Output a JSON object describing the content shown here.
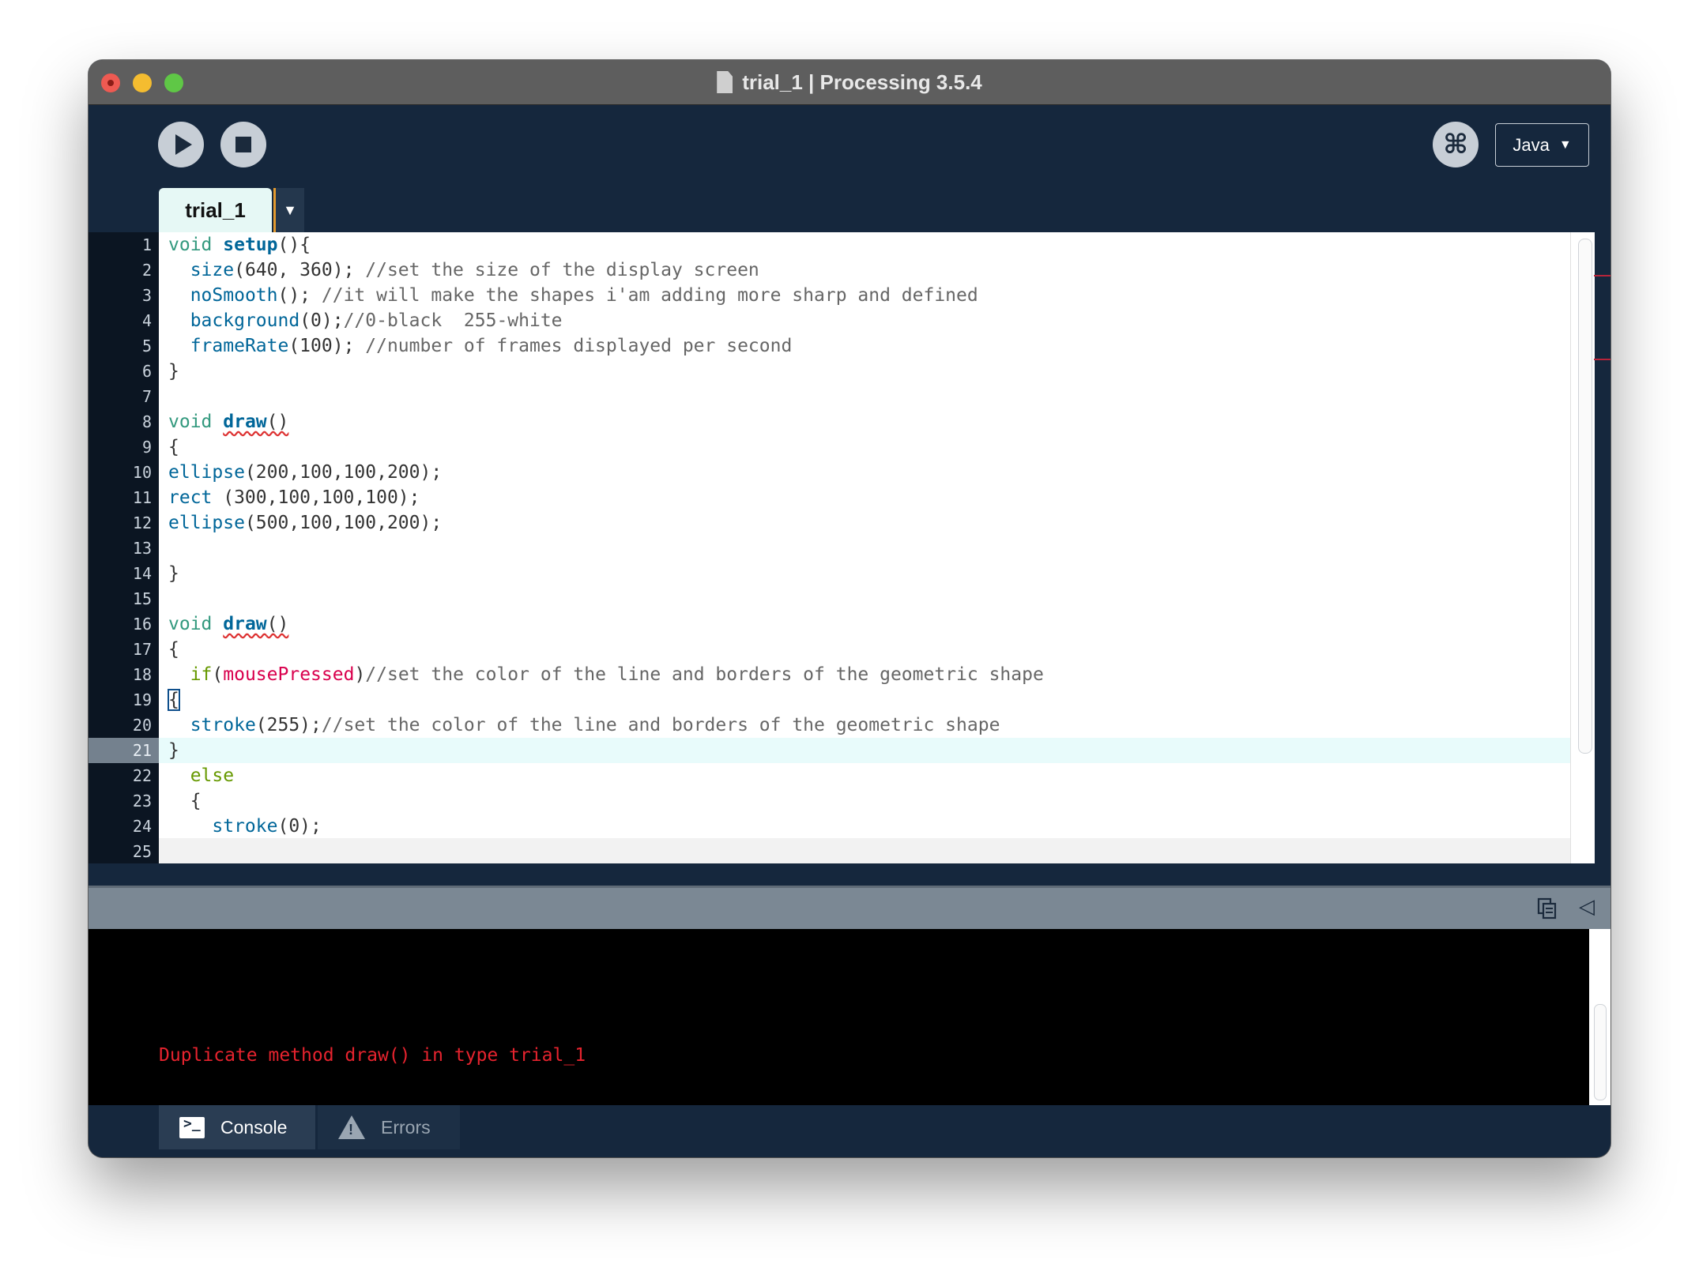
{
  "window": {
    "title": "trial_1 | Processing 3.5.4"
  },
  "toolbar": {
    "run_icon": "play-icon",
    "stop_icon": "stop-icon",
    "debug_icon": "debugger-icon",
    "mode": "Java",
    "mode_arrow": "▼"
  },
  "tab": {
    "name": "trial_1",
    "menu_arrow": "▼"
  },
  "editor": {
    "current_line": 21,
    "line_numbers": [
      "1",
      "2",
      "3",
      "4",
      "5",
      "6",
      "7",
      "8",
      "9",
      "10",
      "11",
      "12",
      "13",
      "14",
      "15",
      "16",
      "17",
      "18",
      "19",
      "20",
      "21",
      "22",
      "23",
      "24",
      "25"
    ],
    "lines": [
      [
        {
          "t": "void",
          "c": "kw"
        },
        {
          "t": " "
        },
        {
          "t": "setup",
          "c": "fnb"
        },
        {
          "t": "(){"
        }
      ],
      [
        {
          "t": "  "
        },
        {
          "t": "size",
          "c": "fn"
        },
        {
          "t": "(640, 360); "
        },
        {
          "t": "//set the size of the display screen",
          "c": "cm"
        }
      ],
      [
        {
          "t": "  "
        },
        {
          "t": "noSmooth",
          "c": "fn"
        },
        {
          "t": "(); "
        },
        {
          "t": "//it will make the shapes i'am adding more sharp and defined",
          "c": "cm"
        }
      ],
      [
        {
          "t": "  "
        },
        {
          "t": "background",
          "c": "fn"
        },
        {
          "t": "(0);"
        },
        {
          "t": "//0-black  255-white",
          "c": "cm"
        }
      ],
      [
        {
          "t": "  "
        },
        {
          "t": "frameRate",
          "c": "fn"
        },
        {
          "t": "(100); "
        },
        {
          "t": "//number of frames displayed per second",
          "c": "cm"
        }
      ],
      [
        {
          "t": "}"
        }
      ],
      [],
      [
        {
          "t": "void",
          "c": "kw"
        },
        {
          "t": " "
        },
        {
          "t": "draw",
          "c": "fnb squig"
        },
        {
          "t": "()",
          "c": "squig"
        }
      ],
      [
        {
          "t": "{"
        }
      ],
      [
        {
          "t": "ellipse",
          "c": "fn"
        },
        {
          "t": "(200,100,100,200);"
        }
      ],
      [
        {
          "t": "rect",
          "c": "fn"
        },
        {
          "t": " (300,100,100,100);"
        }
      ],
      [
        {
          "t": "ellipse",
          "c": "fn"
        },
        {
          "t": "(500,100,100,200);"
        }
      ],
      [],
      [
        {
          "t": "}"
        }
      ],
      [],
      [
        {
          "t": "void",
          "c": "kw"
        },
        {
          "t": " "
        },
        {
          "t": "draw",
          "c": "fnb squig"
        },
        {
          "t": "()",
          "c": "squig"
        }
      ],
      [
        {
          "t": "{"
        }
      ],
      [
        {
          "t": "  "
        },
        {
          "t": "if",
          "c": "if"
        },
        {
          "t": "("
        },
        {
          "t": "mousePressed",
          "c": "var"
        },
        {
          "t": ")"
        },
        {
          "t": "//set the color of the line and borders of the geometric shape",
          "c": "cm"
        }
      ],
      [
        {
          "t": "{",
          "c": "caret-brace"
        }
      ],
      [
        {
          "t": "  "
        },
        {
          "t": "stroke",
          "c": "fn"
        },
        {
          "t": "(255);"
        },
        {
          "t": "//set the color of the line and borders of the geometric shape",
          "c": "cm"
        }
      ],
      [
        {
          "t": "}"
        }
      ],
      [
        {
          "t": "  "
        },
        {
          "t": "else",
          "c": "if"
        }
      ],
      [
        {
          "t": "  {"
        }
      ],
      [
        {
          "t": "    "
        },
        {
          "t": "stroke",
          "c": "fn"
        },
        {
          "t": "(0);"
        }
      ],
      []
    ]
  },
  "console_panel": {
    "copy_icon": "copy-icon",
    "collapse_icon": "collapse-icon",
    "message": "Duplicate method draw() in type trial_1",
    "message_color": "#e6232e"
  },
  "footer": {
    "console_label": "Console",
    "errors_label": "Errors",
    "console_icon": "terminal-icon",
    "errors_icon": "warning-icon"
  },
  "colors": {
    "chrome": "#15273d",
    "titlebar": "#5e5e5e",
    "tab_bg": "#e6f8f5",
    "tab_accent": "#e39a2e",
    "keyword": "#33997e",
    "function": "#006699",
    "comment": "#666666"
  }
}
